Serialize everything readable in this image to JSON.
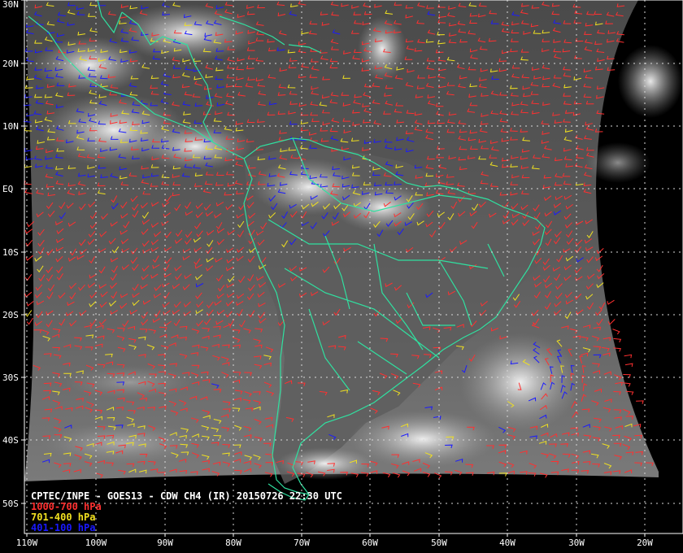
{
  "caption": {
    "title": "CPTEC/INPE - GOES13 - CDW CH4 (IR) 20150726 22:30 UTC",
    "legend": [
      {
        "label": "1000-700 hPa",
        "color": "#ff3030"
      },
      {
        "label": "701-400 hPa",
        "color": "#f0e020"
      },
      {
        "label": "401-100 hPa",
        "color": "#1a1aff"
      }
    ]
  },
  "lat_labels": [
    "30N",
    "20N",
    "10N",
    "EQ",
    "10S",
    "20S",
    "30S",
    "40S",
    "50S"
  ],
  "lon_labels": [
    "110W",
    "100W",
    "90W",
    "80W",
    "70W",
    "60W",
    "50W",
    "40W",
    "30W",
    "20W"
  ],
  "colors": {
    "background": "#000000",
    "coastline": "#30e0a0",
    "grid": "#d0d0d0"
  }
}
